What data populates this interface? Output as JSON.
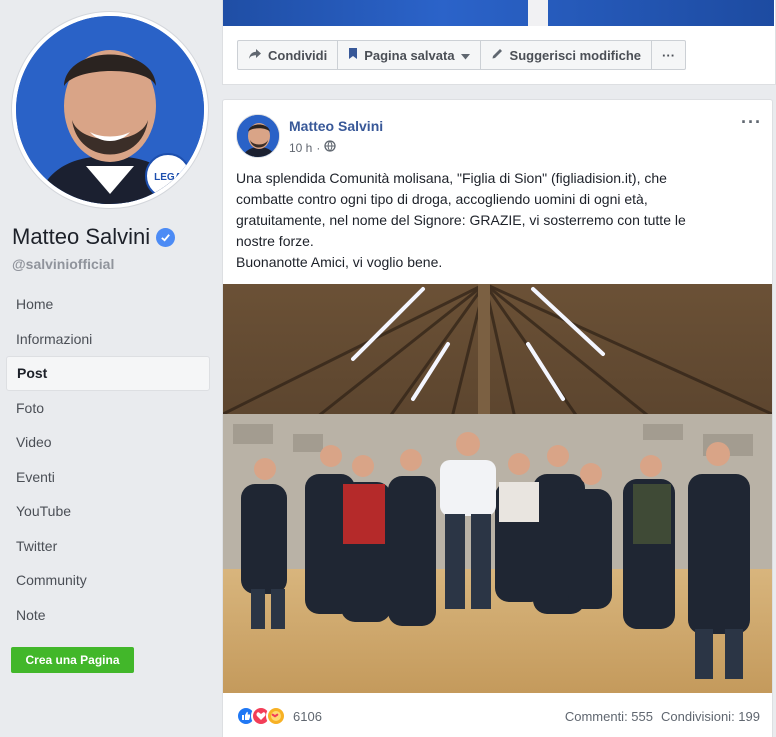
{
  "sidebar": {
    "page_name": "Matteo Salvini",
    "username": "@salviniofficial",
    "nav": [
      "Home",
      "Informazioni",
      "Post",
      "Foto",
      "Video",
      "Eventi",
      "YouTube",
      "Twitter",
      "Community",
      "Note"
    ],
    "active_nav": "Post",
    "create_page_label": "Crea una Pagina",
    "avatar_badge": "LEGA"
  },
  "actions": {
    "share": "Condividi",
    "saved": "Pagina salvata",
    "suggest": "Suggerisci modifiche",
    "more": "···"
  },
  "post": {
    "author": "Matteo Salvini",
    "time": "10 h",
    "more": "···",
    "text_lines": [
      "Una splendida Comunità molisana, \"Figlia di Sion\" (figliadision.it), che",
      "combatte contro ogni tipo di droga, accogliendo uomini di ogni età,",
      "gratuitamente, nel nome del Signore: GRAZIE, vi sosterremo con tutte le",
      "nostre forze.",
      "Buonanotte Amici, vi voglio bene."
    ],
    "reaction_count": "6106",
    "comments": "Commenti: 555",
    "shares": "Condivisioni: 199"
  },
  "colors": {
    "accent": "#385898",
    "create_button": "#42b72a",
    "like": "#2078f4",
    "love": "#f33e58",
    "care": "#f7b125"
  },
  "icons": [
    "share-icon",
    "bookmark-icon",
    "pencil-icon",
    "more-icon",
    "globe-icon",
    "verified-icon",
    "like-icon",
    "love-icon",
    "care-icon"
  ]
}
